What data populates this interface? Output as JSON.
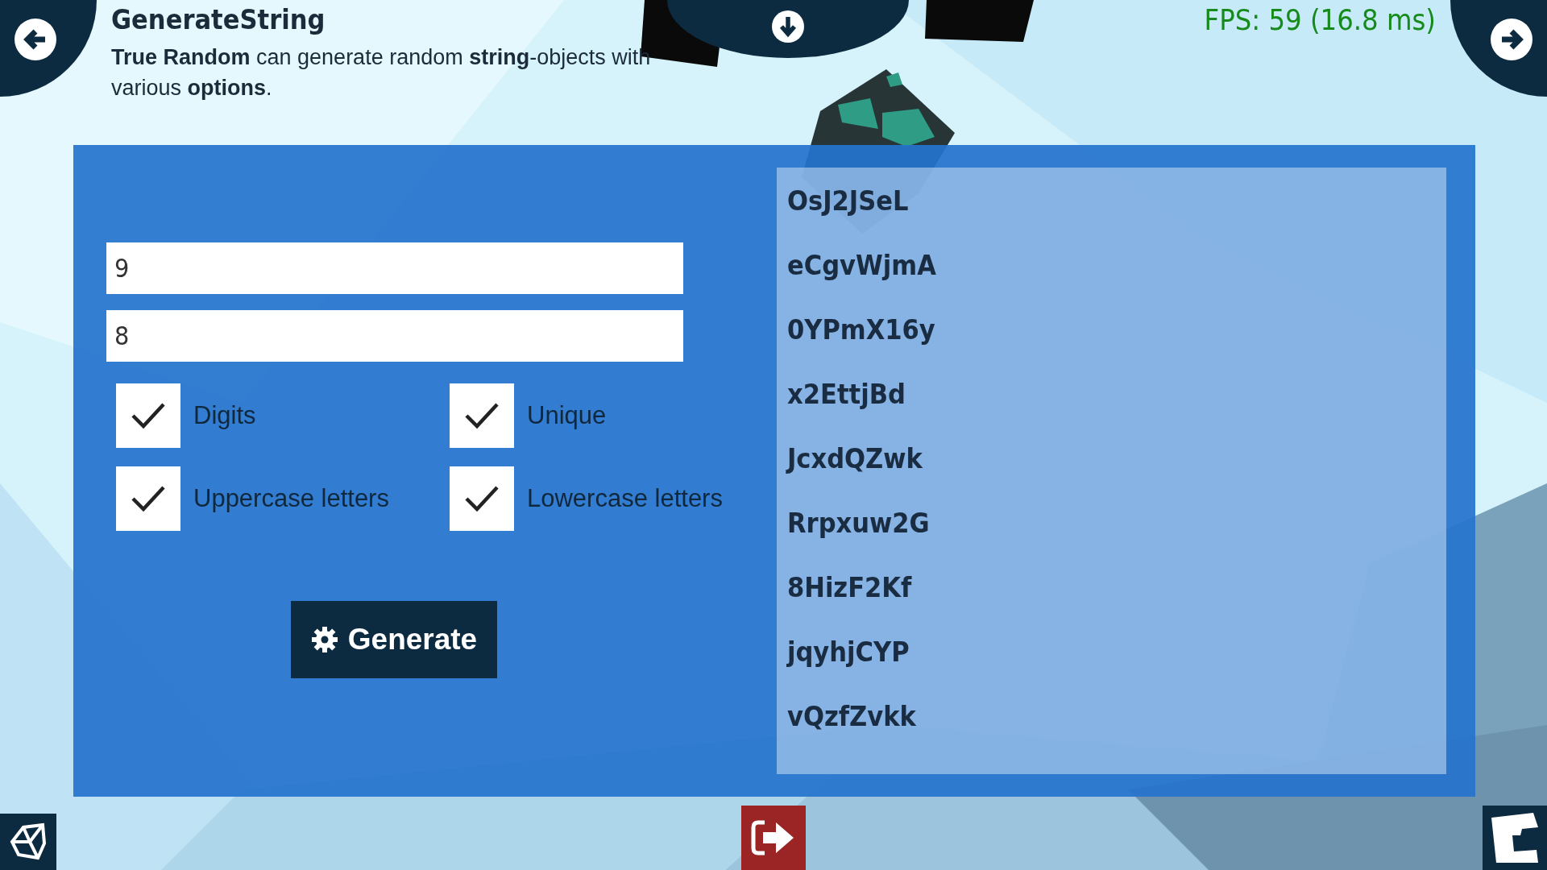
{
  "header": {
    "title": "GenerateString",
    "description": "**True Random** can generate random **string**-objects with various **options**.",
    "fps": "FPS: 59 (16.8 ms)"
  },
  "inputs": [
    {
      "value": "9"
    },
    {
      "value": "8"
    }
  ],
  "options": [
    {
      "label": "Digits",
      "checked": true
    },
    {
      "label": "Unique",
      "checked": true
    },
    {
      "label": "Uppercase letters",
      "checked": true
    },
    {
      "label": "Lowercase letters",
      "checked": true
    }
  ],
  "generate_button": {
    "label": "Generate"
  },
  "results": [
    "OsJ2JSeL",
    "eCgvWjmA",
    "0YPmX16y",
    "x2EttjBd",
    "JcxdQZwk",
    "Rrpxuw2G",
    "8HizF2Kf",
    "jqyhjCYP",
    "vQzfZvkk"
  ]
}
